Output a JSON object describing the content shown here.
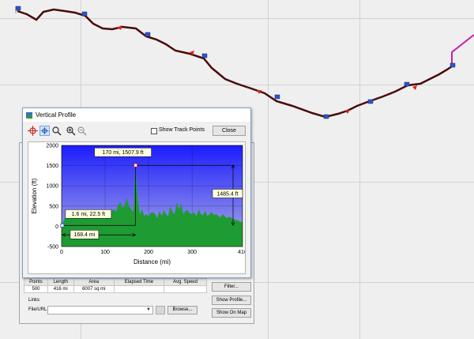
{
  "window": {
    "title": "Vertical Profile"
  },
  "toolbar": {
    "show_track_points_label": "Show Track Points",
    "close_label": "Close"
  },
  "chart_data": {
    "type": "area",
    "xlabel": "Distance  (mi)",
    "ylabel": "Elevation (ft)",
    "xlim": [
      0,
      416
    ],
    "ylim": [
      -500,
      2000
    ],
    "x_ticks": [
      "0",
      "100",
      "200",
      "300",
      "416"
    ],
    "y_ticks": [
      "-500",
      "0",
      "500",
      "1000",
      "1500",
      "2000"
    ],
    "x": [
      0,
      5,
      10,
      15,
      20,
      25,
      30,
      35,
      40,
      45,
      50,
      55,
      60,
      65,
      70,
      75,
      80,
      85,
      90,
      95,
      100,
      105,
      110,
      115,
      120,
      125,
      130,
      135,
      140,
      145,
      150,
      155,
      160,
      165,
      170,
      175,
      180,
      185,
      190,
      195,
      200,
      205,
      210,
      215,
      220,
      225,
      230,
      235,
      240,
      245,
      250,
      255,
      260,
      265,
      270,
      275,
      280,
      285,
      290,
      295,
      300,
      305,
      310,
      315,
      320,
      325,
      330,
      335,
      340,
      345,
      350,
      355,
      360,
      365,
      370,
      375,
      380,
      385,
      390,
      395,
      400,
      405,
      410,
      416
    ],
    "values": [
      22,
      150,
      260,
      300,
      320,
      240,
      380,
      420,
      300,
      360,
      310,
      250,
      280,
      300,
      200,
      260,
      330,
      220,
      300,
      280,
      250,
      350,
      300,
      380,
      420,
      360,
      520,
      600,
      450,
      520,
      700,
      500,
      420,
      350,
      1508,
      650,
      300,
      420,
      260,
      300,
      250,
      330,
      350,
      300,
      200,
      380,
      260,
      400,
      300,
      250,
      500,
      350,
      300,
      600,
      420,
      560,
      300,
      380,
      400,
      320,
      300,
      350,
      250,
      420,
      300,
      280,
      380,
      250,
      300,
      350,
      280,
      300,
      260,
      220,
      300,
      250,
      200,
      240,
      210,
      180,
      160,
      150,
      120,
      100
    ],
    "annotations": {
      "start_point": "1.6 mi, 22.5 ft",
      "peak_point": "170 mi, 1507.9 ft",
      "horizontal_measure": "168.4 mi",
      "vertical_measure": "1485.4 ft"
    },
    "colors": {
      "sky_top": "#1c1cff",
      "sky_bottom": "#aeb0e2",
      "ground": "#1f9b33"
    }
  },
  "track_table": {
    "headers": [
      "Points",
      "Length",
      "Area",
      "Elapsed Time",
      "Avg. Speed"
    ],
    "row": [
      "500",
      "416 mi",
      "6007 sq mi",
      "",
      ""
    ]
  },
  "side_buttons": {
    "filter": "Filter...",
    "show_profile": "Show Profile...",
    "show_on_map": "Show On Map"
  },
  "links": {
    "label": "Links",
    "file_label": "File/URL:",
    "browse_label": "Browse..."
  }
}
